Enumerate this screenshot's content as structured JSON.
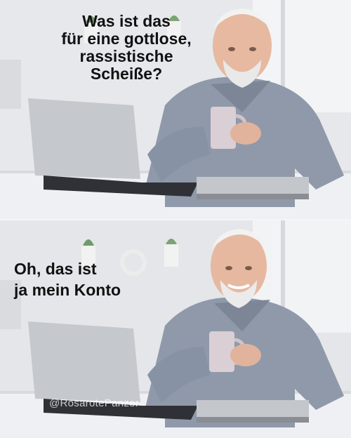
{
  "panels": [
    {
      "caption": "Was ist das\nfür eine gottlose,\nrassistische\nScheiße?"
    },
    {
      "caption": "Oh, das ist\nja mein Konto"
    }
  ],
  "watermark": "@RosarotePanzer",
  "colors": {
    "background": "#e4e6e9",
    "shirt": "#8d97a8",
    "laptop": "#c9cbcf",
    "desk": "#edeff2"
  }
}
